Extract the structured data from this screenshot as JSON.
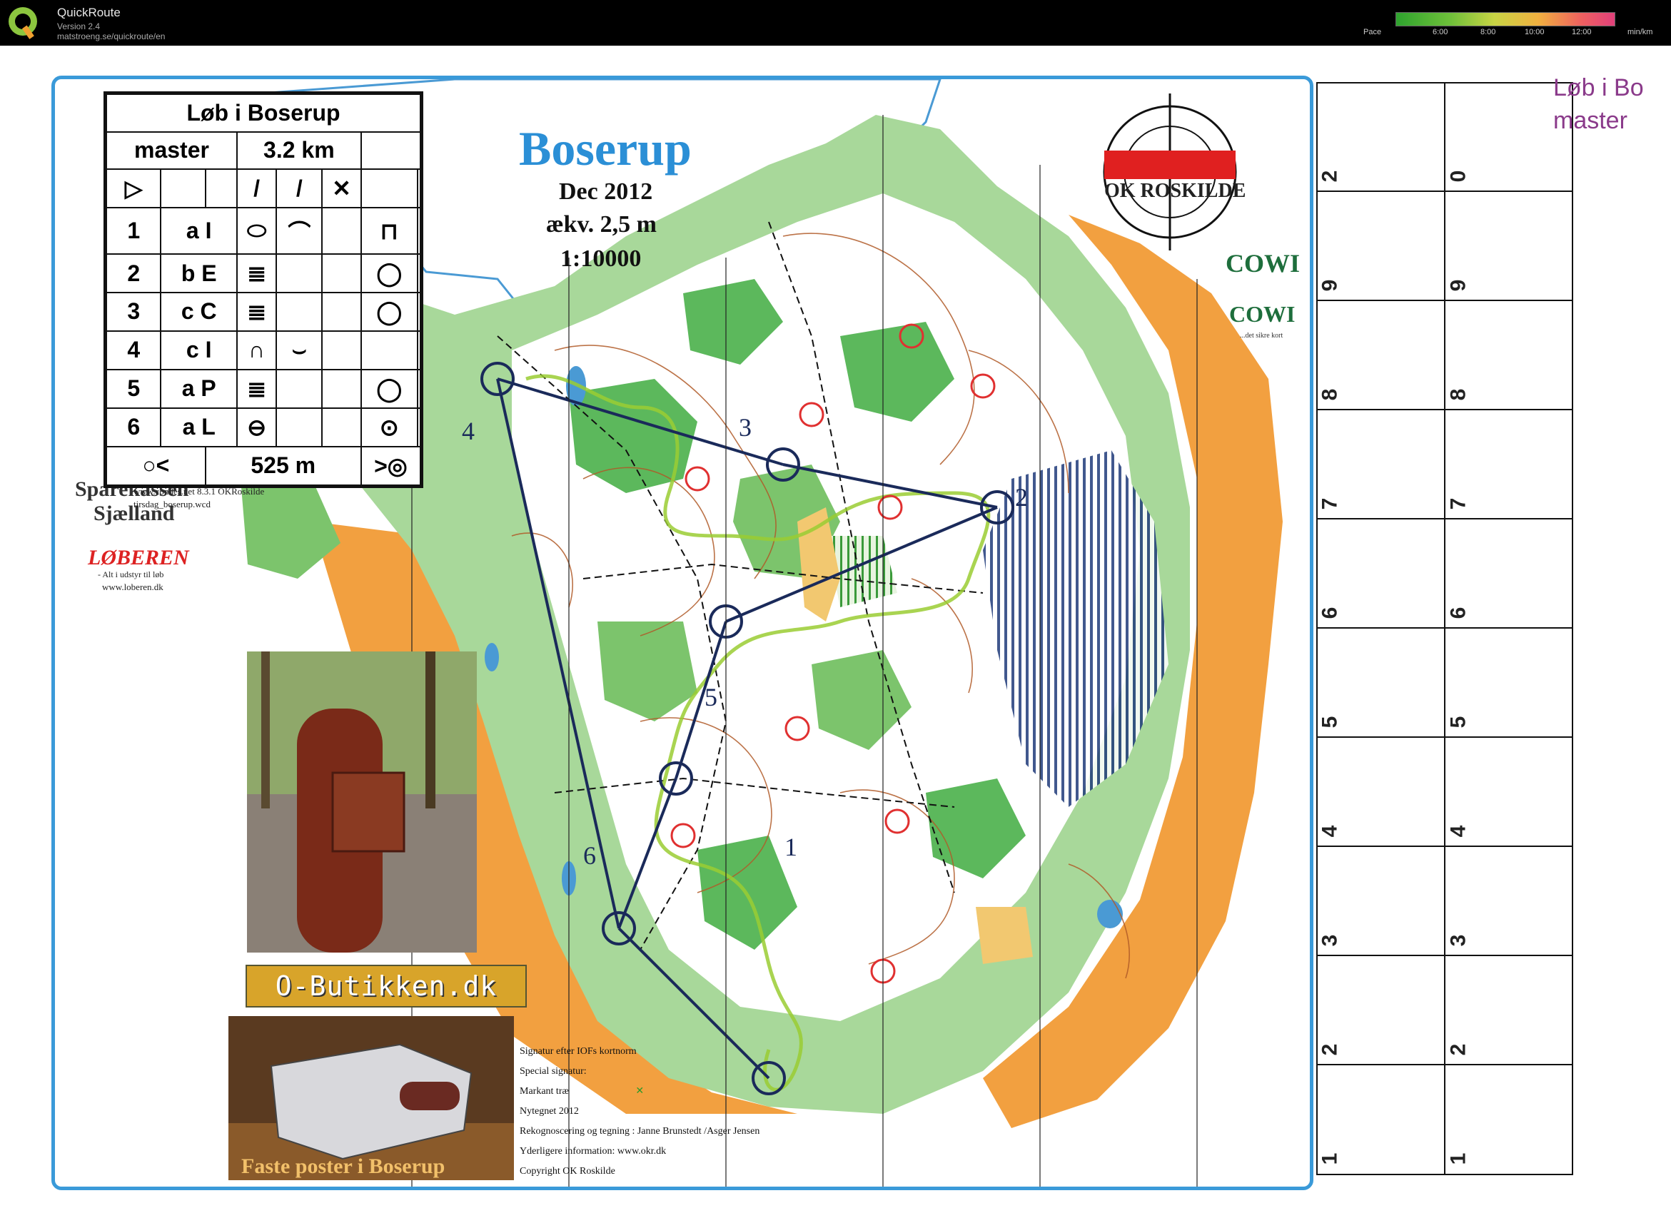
{
  "app": {
    "title": "QuickRoute",
    "version": "Version 2.4",
    "url": "matstroeng.se/quickroute/en"
  },
  "pace_legend": {
    "label": "Pace",
    "ticks": [
      "6:00",
      "8:00",
      "10:00",
      "12:00"
    ],
    "unit": "min/km"
  },
  "map": {
    "title": "Boserup",
    "date": "Dec 2012",
    "contour": "ækv. 2,5 m",
    "scale": "1:10000",
    "club_logo": "OK ROSKILDE",
    "sponsor": "COWI",
    "sponsor_tagline": "...det sikre kort",
    "sponsor2_line1": "Sparekassen",
    "sponsor2_line2": "Sjælland",
    "loberen": "LØBEREN",
    "loberen_tagline": "- Alt i udstyr til løb",
    "loberen_url": "www.loberen.dk",
    "ocad_line1": "www.condes.net 8.3.1 OKRoskilde",
    "ocad_line2": "tirsdag_boserup.wcd",
    "butik": "O-Butikken.dk",
    "faste_poster": "Faste poster i Boserup",
    "control_labels": [
      "1",
      "2",
      "3",
      "4",
      "5",
      "6"
    ],
    "colors": {
      "forest_green": "#5cb85c",
      "light_green": "#a8d89a",
      "open_orange": "#f2a040",
      "water": "#4a9ad4",
      "course_line": "#1a2a5a",
      "contour": "#b05a28"
    }
  },
  "description_sheet": {
    "event": "Løb i Boserup",
    "class": "master",
    "distance": "3.2 km",
    "controls": [
      {
        "num": "1",
        "code": "a I"
      },
      {
        "num": "2",
        "code": "b E"
      },
      {
        "num": "3",
        "code": "c C"
      },
      {
        "num": "4",
        "code": "c I"
      },
      {
        "num": "5",
        "code": "a P"
      },
      {
        "num": "6",
        "code": "a L"
      }
    ],
    "finish_distance": "525 m"
  },
  "map_info": {
    "lines": [
      "Signatur  efter IOFs kortnorm",
      "Special signatur:",
      "Markant træ",
      "Nytegnet 2012",
      "Rekognoscering og tegning : Janne Brunstedt /Asger Jensen",
      "Yderligere information: www.okr.dk",
      "Copyright  OK Roskilde"
    ]
  },
  "side_panel": {
    "title_line1": "Løb i Bo",
    "title_line2": "master",
    "left_numbers": [
      "2",
      "9",
      "8",
      "7",
      "6",
      "5",
      "4",
      "3",
      "2",
      "1"
    ],
    "right_numbers": [
      "0",
      "9",
      "8",
      "7",
      "6",
      "5",
      "4",
      "3",
      "2",
      "1"
    ]
  }
}
